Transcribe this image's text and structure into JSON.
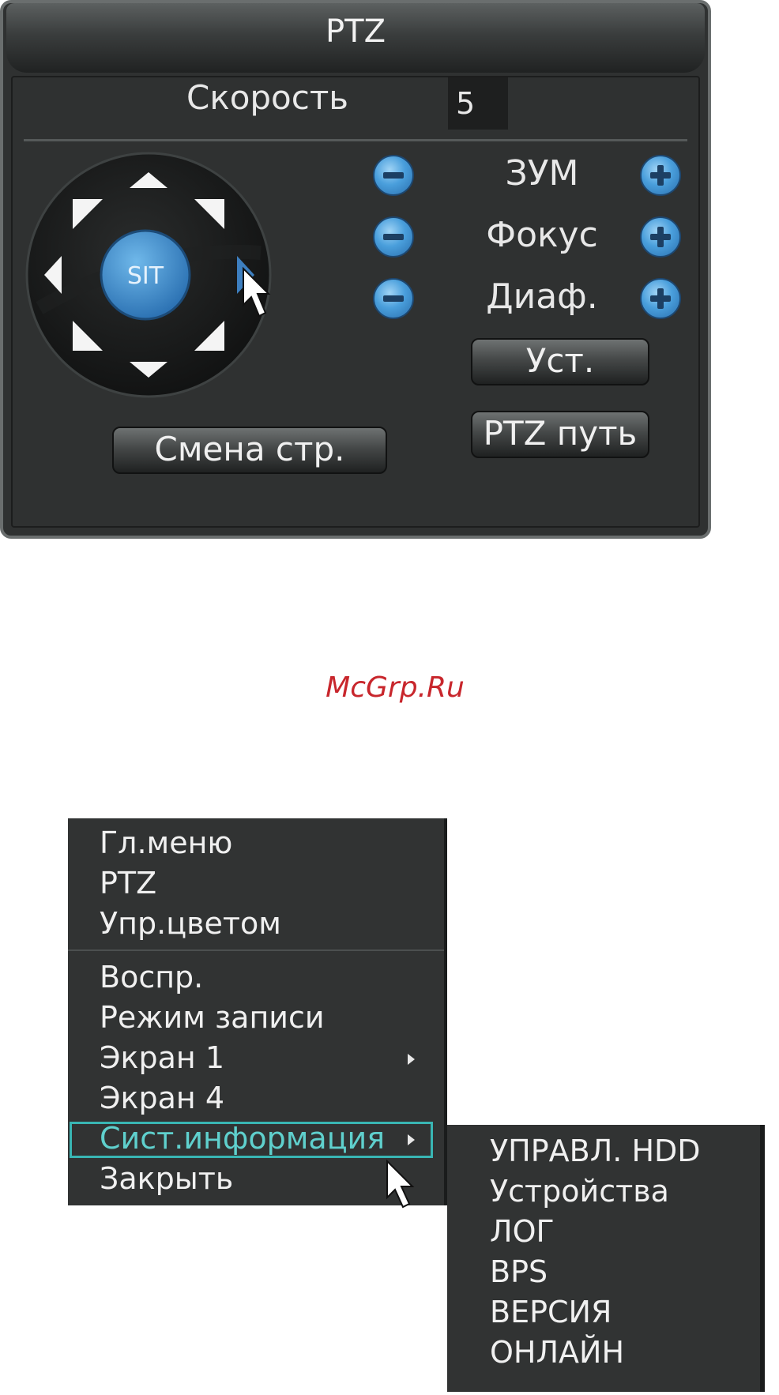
{
  "ptz": {
    "title": "PTZ",
    "speed_label": "Скорость",
    "speed_value": "5",
    "center_label": "SIT",
    "controls": [
      {
        "label": "ЗУМ"
      },
      {
        "label": "Фокус"
      },
      {
        "label": "Диаф."
      }
    ],
    "set_button": "Уст.",
    "path_button": "PTZ путь",
    "page_button": "Смена стр."
  },
  "watermark": "McGrp.Ru",
  "menu": {
    "items": [
      {
        "label": "Гл.меню"
      },
      {
        "label": "PTZ"
      },
      {
        "label": "Упр.цветом"
      },
      {
        "label": "Воспр."
      },
      {
        "label": "Режим записи"
      },
      {
        "label": "Экран 1"
      },
      {
        "label": "Экран 4"
      },
      {
        "label": "Сист.информация"
      },
      {
        "label": "Закрыть"
      }
    ],
    "highlighted_index": 7
  },
  "submenu": {
    "items": [
      {
        "label": "УПРАВЛ. HDD"
      },
      {
        "label": "Устройства"
      },
      {
        "label": "ЛОГ"
      },
      {
        "label": "BPS"
      },
      {
        "label": "ВЕРСИЯ"
      },
      {
        "label": "ОНЛАЙН"
      }
    ]
  },
  "colors": {
    "accent_blue": "#4a9fdc",
    "highlight_teal": "#39b6b4",
    "watermark_red": "#c8262c"
  }
}
